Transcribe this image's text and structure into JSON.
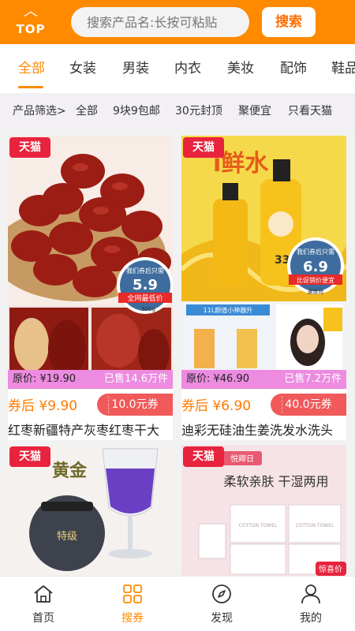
{
  "header": {
    "top_label": "TOP",
    "search_placeholder": "搜索产品名:长按可粘贴",
    "search_button": "搜索",
    "accent": "#ff8a00"
  },
  "tabs": [
    "全部",
    "女装",
    "男装",
    "内衣",
    "美妆",
    "配饰",
    "鞋品"
  ],
  "filter": {
    "label": "产品筛选>",
    "items": [
      "全部",
      "9块9包邮",
      "30元封顶",
      "聚便宜",
      "只看天猫"
    ]
  },
  "products": [
    {
      "badge": "天猫",
      "image_title": "",
      "coupon_bubble_top": "我们券后只需",
      "coupon_bubble_price": "5.9",
      "coupon_bubble_ribbon": "全网最低价",
      "coupon_bubble_weight": "500g",
      "original_price": "原价: ¥19.90",
      "sold": "已售14.6万件",
      "after_coupon": "券后 ¥9.90",
      "coupon": "10.0元券",
      "title": "红枣新疆特产灰枣红枣干大"
    },
    {
      "badge": "天猫",
      "image_title": "i鲜水",
      "coupon_bubble_top": "我们券后只需",
      "coupon_bubble_price": "6.9",
      "coupon_bubble_ribbon": "比促销价便宜",
      "coupon_bubble_weight": "速度抢",
      "bottle_number": "33",
      "strip_text": "11L颜值小神器升",
      "original_price": "原价: ¥46.90",
      "sold": "已售7.2万件",
      "after_coupon": "券后 ¥6.90",
      "coupon": "40.0元券",
      "title": "迪彩无硅油生姜洗发水洗头"
    },
    {
      "badge": "天猫",
      "image_title": "黄金",
      "can_label": "特级"
    },
    {
      "badge": "天猫",
      "image_title": "柔软亲肤 干湿两用",
      "brand_label": "悦卿日",
      "corner_label": "惊喜价",
      "pack_label": "COTTON TOWEL"
    }
  ],
  "nav": [
    {
      "label": "首页",
      "icon": "home-icon"
    },
    {
      "label": "搜券",
      "icon": "grid-icon"
    },
    {
      "label": "发现",
      "icon": "compass-icon"
    },
    {
      "label": "我的",
      "icon": "user-icon"
    }
  ]
}
